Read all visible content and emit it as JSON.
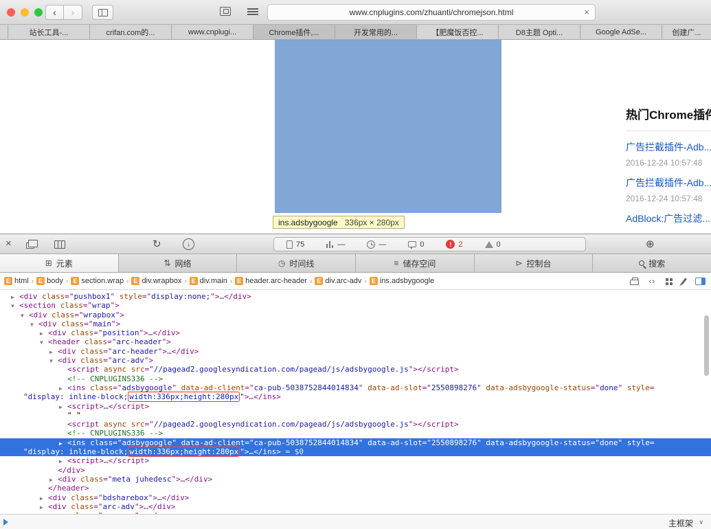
{
  "colors": {
    "accent_blue": "#3273df",
    "highlight_overlay": "#6091ca",
    "error_red": "#e23b3b",
    "red_box": "#ff2d21",
    "link_blue": "#1a56c4",
    "badge_orange": "#ef9f3f",
    "tooltip_bg": "#fdf9c8"
  },
  "browser": {
    "url": "www.cnplugins.com/zhuanti/chromejson.html",
    "back_glyph": "‹",
    "forward_glyph": "›",
    "stop_glyph": "×",
    "tabs": [
      {
        "label": "",
        "fragment": true
      },
      {
        "label": "站长工具-..."
      },
      {
        "label": "crifan.com的..."
      },
      {
        "label": "www.cnplugi..."
      },
      {
        "label": "Chrome插件,...",
        "dark": true
      },
      {
        "label": "开发常用的...",
        "dark": true
      },
      {
        "label": "【肥魔饭否控..."
      },
      {
        "label": "D8主题 Opti..."
      },
      {
        "label": "Google AdSe..."
      },
      {
        "label": "创建广..."
      }
    ]
  },
  "page": {
    "highlight": {
      "element": "ins.adsbygoogle",
      "size": "336px × 280px"
    },
    "sidebar": {
      "heading": "热门Chrome插件",
      "items": [
        {
          "title": "广告拦截插件-Adb...",
          "date": "2016-12-24 10:57:48"
        },
        {
          "title": "广告拦截插件-Adb...",
          "date": "2016-12-24 10:57:48"
        },
        {
          "title": "AdBlock:广告过滤...",
          "date": ""
        }
      ]
    }
  },
  "inspector": {
    "toolbar": {
      "close_glyph": "×",
      "reload_glyph": "↻",
      "download_glyph": "↓",
      "target_glyph": "⊕",
      "resources": "75",
      "network_time": "—",
      "elapsed": "—",
      "logs": "0",
      "error_glyph": "!",
      "errors": "2",
      "warnings": "0"
    },
    "tabs": [
      {
        "key": "elements",
        "label": "元素",
        "active": true
      },
      {
        "key": "network",
        "label": "网络"
      },
      {
        "key": "timelines",
        "label": "时间线"
      },
      {
        "key": "storage",
        "label": "储存空间"
      },
      {
        "key": "console",
        "label": "控制台"
      },
      {
        "key": "search",
        "label": "搜索"
      }
    ],
    "tab_icon_glyphs": {
      "elements": "⊞",
      "network": "⇅",
      "timelines": "◷",
      "storage": "≡",
      "console": "⊳",
      "search": ""
    },
    "breadcrumbs": [
      "html",
      "body",
      "section.wrap",
      "div.wrapbox",
      "div.main",
      "header.arc-header",
      "div.arc-adv",
      "ins.adsbygoogle"
    ],
    "crumb_badge": "E",
    "crumb_separator": "›",
    "code_icon_glyph": "‹›",
    "status": {
      "frame": "主框架",
      "chevron": "∨"
    },
    "dom": [
      {
        "lvl": 0,
        "arrow": "c",
        "tokens": [
          [
            "t",
            "<div "
          ],
          [
            "a",
            "class"
          ],
          [
            "t",
            "=\""
          ],
          [
            "v",
            "pushbox1"
          ],
          [
            "t",
            "\" "
          ],
          [
            "a",
            "style"
          ],
          [
            "t",
            "=\""
          ],
          [
            "v",
            "display:none;"
          ],
          [
            "t",
            "\">"
          ],
          [
            "d",
            "…"
          ],
          [
            "t",
            "</div>"
          ]
        ]
      },
      {
        "lvl": 0,
        "arrow": "e",
        "tokens": [
          [
            "t",
            "<section "
          ],
          [
            "a",
            "class"
          ],
          [
            "t",
            "=\""
          ],
          [
            "v",
            "wrap"
          ],
          [
            "t",
            "\">"
          ]
        ]
      },
      {
        "lvl": 1,
        "arrow": "e",
        "tokens": [
          [
            "t",
            "<div "
          ],
          [
            "a",
            "class"
          ],
          [
            "t",
            "=\""
          ],
          [
            "v",
            "wrapbox"
          ],
          [
            "t",
            "\">"
          ]
        ]
      },
      {
        "lvl": 2,
        "arrow": "e",
        "tokens": [
          [
            "t",
            "<div "
          ],
          [
            "a",
            "class"
          ],
          [
            "t",
            "=\""
          ],
          [
            "v",
            "main"
          ],
          [
            "t",
            "\">"
          ]
        ]
      },
      {
        "lvl": 3,
        "arrow": "c",
        "tokens": [
          [
            "t",
            "<div "
          ],
          [
            "a",
            "class"
          ],
          [
            "t",
            "=\""
          ],
          [
            "v",
            "position"
          ],
          [
            "t",
            "\">"
          ],
          [
            "d",
            "…"
          ],
          [
            "t",
            "</div>"
          ]
        ]
      },
      {
        "lvl": 3,
        "arrow": "e",
        "tokens": [
          [
            "t",
            "<header "
          ],
          [
            "a",
            "class"
          ],
          [
            "t",
            "=\""
          ],
          [
            "v",
            "arc-header"
          ],
          [
            "t",
            "\">"
          ]
        ]
      },
      {
        "lvl": 4,
        "arrow": "c",
        "tokens": [
          [
            "t",
            "<div "
          ],
          [
            "a",
            "class"
          ],
          [
            "t",
            "=\""
          ],
          [
            "v",
            "arc-header"
          ],
          [
            "t",
            "\">"
          ],
          [
            "d",
            "…"
          ],
          [
            "t",
            "</div>"
          ]
        ]
      },
      {
        "lvl": 4,
        "arrow": "e",
        "tokens": [
          [
            "t",
            "<div "
          ],
          [
            "a",
            "class"
          ],
          [
            "t",
            "=\""
          ],
          [
            "v",
            "arc-adv"
          ],
          [
            "t",
            "\">"
          ]
        ]
      },
      {
        "lvl": 5,
        "arrow": "",
        "tokens": [
          [
            "t",
            "<script "
          ],
          [
            "a",
            "async"
          ],
          [
            "t",
            " "
          ],
          [
            "a",
            "src"
          ],
          [
            "t",
            "=\""
          ],
          [
            "v",
            "//pagead2.googlesyndication.com/pagead/js/adsbygoogle.js"
          ],
          [
            "t",
            "\"></script>"
          ]
        ]
      },
      {
        "lvl": 5,
        "arrow": "",
        "tokens": [
          [
            "c",
            "<!-- CNPLUGINS336 -->"
          ]
        ]
      },
      {
        "lvl": 5,
        "arrow": "c",
        "tokens": [
          [
            "t",
            "<ins "
          ],
          [
            "a",
            "class"
          ],
          [
            "t",
            "=\""
          ],
          [
            "v",
            "adsbygoogle"
          ],
          [
            "t",
            "\" "
          ],
          [
            "a",
            "data-ad-client"
          ],
          [
            "t",
            "=\""
          ],
          [
            "v",
            "ca-pub-5038752844014834"
          ],
          [
            "t",
            "\" "
          ],
          [
            "a",
            "data-ad-slot"
          ],
          [
            "t",
            "=\""
          ],
          [
            "v",
            "2550898276"
          ],
          [
            "t",
            "\" "
          ],
          [
            "a",
            "data-adsbygoogle-status"
          ],
          [
            "t",
            "=\""
          ],
          [
            "v",
            "done"
          ],
          [
            "t",
            "\" "
          ],
          [
            "a",
            "style"
          ],
          [
            "t",
            "="
          ]
        ]
      },
      {
        "cont": true,
        "arrow": "",
        "tokens": [
          [
            "v",
            "\"display: inline-block;"
          ],
          [
            "r",
            "width:336px;height:280px"
          ],
          [
            "v",
            "\""
          ],
          [
            "t",
            ">"
          ],
          [
            "d",
            "…"
          ],
          [
            "t",
            "</ins>"
          ]
        ]
      },
      {
        "lvl": 5,
        "arrow": "c",
        "tokens": [
          [
            "t",
            "<script>"
          ],
          [
            "d",
            "…"
          ],
          [
            "t",
            "</script>"
          ]
        ]
      },
      {
        "lvl": 5,
        "arrow": "",
        "tokens": [
          [
            "x",
            "\" \""
          ]
        ]
      },
      {
        "lvl": 5,
        "arrow": "",
        "tokens": [
          [
            "t",
            "<script "
          ],
          [
            "a",
            "async"
          ],
          [
            "t",
            " "
          ],
          [
            "a",
            "src"
          ],
          [
            "t",
            "=\""
          ],
          [
            "v",
            "//pagead2.googlesyndication.com/pagead/js/adsbygoogle.js"
          ],
          [
            "t",
            "\"></script>"
          ]
        ]
      },
      {
        "lvl": 5,
        "arrow": "",
        "tokens": [
          [
            "c",
            "<!-- CNPLUGINS336 -->"
          ]
        ]
      },
      {
        "lvl": 5,
        "arrow": "c",
        "sel": true,
        "tokens": [
          [
            "t",
            "<ins "
          ],
          [
            "a",
            "class"
          ],
          [
            "t",
            "=\""
          ],
          [
            "v",
            "adsbygoogle"
          ],
          [
            "t",
            "\" "
          ],
          [
            "a",
            "data-ad-client"
          ],
          [
            "t",
            "=\""
          ],
          [
            "v",
            "ca-pub-5038752844014834"
          ],
          [
            "t",
            "\" "
          ],
          [
            "a",
            "data-ad-slot"
          ],
          [
            "t",
            "=\""
          ],
          [
            "v",
            "2550898276"
          ],
          [
            "t",
            "\" "
          ],
          [
            "a",
            "data-adsbygoogle-status"
          ],
          [
            "t",
            "=\""
          ],
          [
            "v",
            "done"
          ],
          [
            "t",
            "\" "
          ],
          [
            "a",
            "style"
          ],
          [
            "t",
            "="
          ]
        ]
      },
      {
        "cont": true,
        "sel": true,
        "arrow": "",
        "tokens": [
          [
            "v",
            "\"display: inline-block;"
          ],
          [
            "r",
            "width:336px;height:280px"
          ],
          [
            "v",
            "\""
          ],
          [
            "t",
            ">"
          ],
          [
            "d",
            "…"
          ],
          [
            "t",
            "</ins>"
          ],
          [
            "s",
            " = $0"
          ]
        ]
      },
      {
        "lvl": 5,
        "arrow": "c",
        "tokens": [
          [
            "t",
            "<script>"
          ],
          [
            "d",
            "…"
          ],
          [
            "t",
            "</script>"
          ]
        ]
      },
      {
        "lvl": 4,
        "arrow": "",
        "tokens": [
          [
            "t",
            "</div>"
          ]
        ]
      },
      {
        "lvl": 4,
        "arrow": "c",
        "tokens": [
          [
            "t",
            "<div "
          ],
          [
            "a",
            "class"
          ],
          [
            "t",
            "=\""
          ],
          [
            "v",
            "meta juhedesc"
          ],
          [
            "t",
            "\">"
          ],
          [
            "d",
            "…"
          ],
          [
            "t",
            "</div>"
          ]
        ]
      },
      {
        "lvl": 3,
        "arrow": "",
        "tokens": [
          [
            "t",
            "</header>"
          ]
        ]
      },
      {
        "lvl": 3,
        "arrow": "c",
        "tokens": [
          [
            "t",
            "<div "
          ],
          [
            "a",
            "class"
          ],
          [
            "t",
            "=\""
          ],
          [
            "v",
            "bdsharebox"
          ],
          [
            "t",
            "\">"
          ],
          [
            "d",
            "…"
          ],
          [
            "t",
            "</div>"
          ]
        ]
      },
      {
        "lvl": 3,
        "arrow": "c",
        "tokens": [
          [
            "t",
            "<div "
          ],
          [
            "a",
            "class"
          ],
          [
            "t",
            "=\""
          ],
          [
            "v",
            "arc-adv"
          ],
          [
            "t",
            "\">"
          ],
          [
            "d",
            "…"
          ],
          [
            "t",
            "</div>"
          ]
        ]
      },
      {
        "lvl": 3,
        "arrow": "c",
        "tokens": [
          [
            "t",
            "<nav "
          ],
          [
            "a",
            "class"
          ],
          [
            "t",
            "=\""
          ],
          [
            "v",
            "arc-nav"
          ],
          [
            "t",
            "\">"
          ],
          [
            "d",
            "…"
          ],
          [
            "t",
            "</nav>"
          ]
        ]
      }
    ]
  }
}
